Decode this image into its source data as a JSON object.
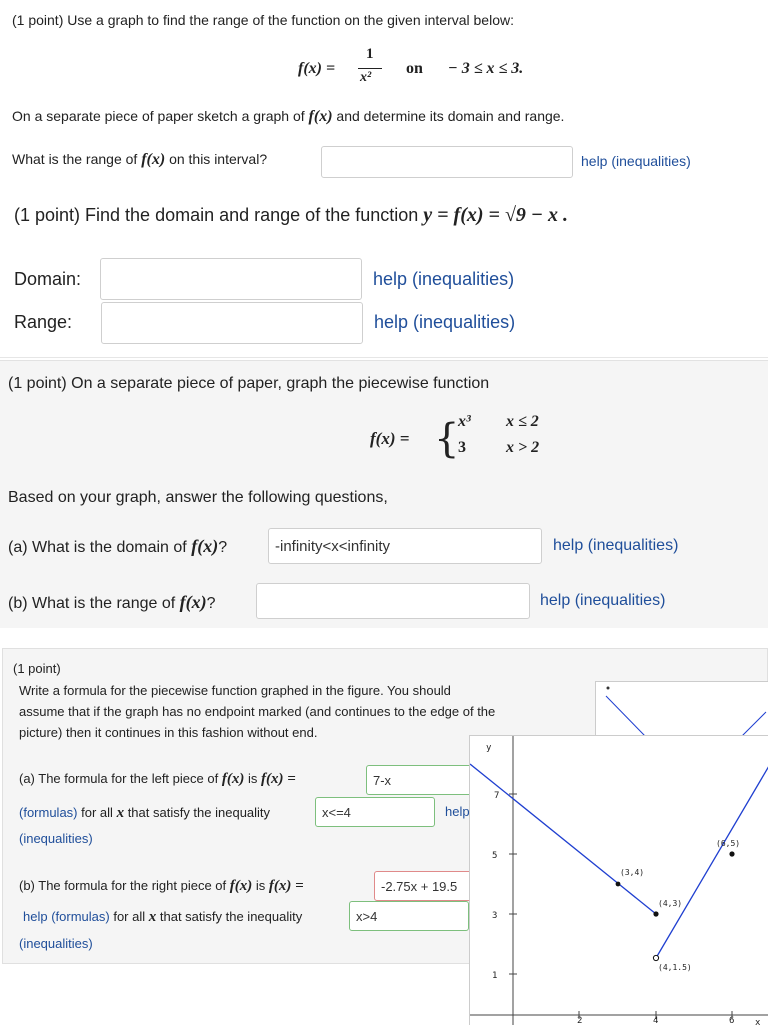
{
  "p1": {
    "header": "(1 point) Use a graph to find the range of the function on the given interval below:",
    "fx": "f(x) =",
    "num": "1",
    "den": "x²",
    "on": "on",
    "interval": "− 3 ≤ x ≤ 3.",
    "instruction_pre": "On a separate piece of paper sketch a graph of",
    "instruction_fx": "f(x)",
    "instruction_post": "and determine its domain and range.",
    "question_pre": "What is the range of",
    "question_fx": "f(x)",
    "question_post": "on this interval?",
    "answer_value": "",
    "help": "help (inequalities)"
  },
  "p2": {
    "header_pre": "(1 point) Find the domain and range of the function",
    "header_eq": "y = f(x) = √9 − x .",
    "domain_label": "Domain:",
    "domain_value": "",
    "range_label": "Range:",
    "range_value": "",
    "help_domain": "help (inequalities)",
    "help_range": "help (inequalities)"
  },
  "p3": {
    "header": "(1 point) On a separate piece of paper, graph the piecewise function",
    "fx": "f(x) =",
    "case1_expr": "x³",
    "case1_cond": "x ≤ 2",
    "case2_expr": "3",
    "case2_cond": "x > 2",
    "based": "Based on your graph, answer the following questions,",
    "qa_pre": "(a) What is the domain of",
    "qa_fx": "f(x)",
    "qa_post": "?",
    "qa_value": "-infinity<x<infinity",
    "qb_pre": "(b) What is the range of",
    "qb_fx": "f(x)",
    "qb_post": "?",
    "qb_value": "",
    "help_a": "help (inequalities)",
    "help_b": "help (inequalities)"
  },
  "p4": {
    "header": "(1 point)",
    "line1": "Write a formula for the piecewise function graphed in the figure. You should",
    "line2": "assume that if the graph has no endpoint marked (and continues to the edge of the",
    "line3": "picture) then it continues in this fashion without end.",
    "a_pre": "(a) The formula for the left piece of",
    "a_fx": "f(x)",
    "a_is": "is",
    "a_eq": "f(x) =",
    "a_value": "7-x",
    "a2_link": "(formulas)",
    "a2_text": "for all",
    "a2_x": "x",
    "a2_post": "that satisfy the inequality",
    "a2_value": "x<=4",
    "a_help_partial": "help",
    "a3_link": "(inequalities)",
    "b_pre": "(b) The formula for the right piece of",
    "b_fx": "f(x)",
    "b_is": "is",
    "b_eq": "f(x) =",
    "b_value": "-2.75x + 19.5",
    "b2_link": "help (formulas)",
    "b2_text": "for all",
    "b2_x": "x",
    "b2_post": "that satisfy the inequality",
    "b2_value": "x>4",
    "b3_link": "(inequalities)",
    "graph": {
      "y_axis_label": "y",
      "x_axis_label": "x",
      "y_ticks": [
        "7",
        "5",
        "3",
        "1"
      ],
      "x_ticks": [
        "2",
        "4",
        "6"
      ],
      "pt_3_4": "(3,4)",
      "pt_4_3": "(4,3)",
      "pt_6_5": "(6,5)",
      "pt_4_15": "(4,1.5)"
    }
  },
  "colors": {
    "link": "#1f4e9a",
    "graph_line": "#1f3fd0"
  }
}
